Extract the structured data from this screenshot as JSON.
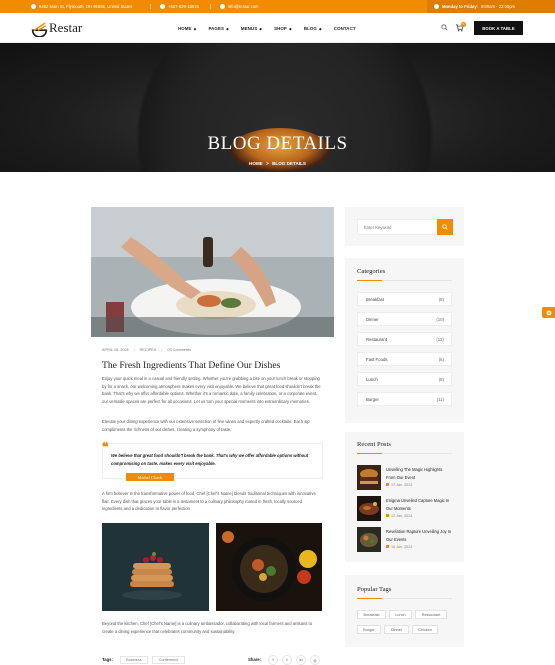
{
  "topbar": {
    "address": "9482 Main St, Plymouth, OH 95665, United States",
    "phone": "+567-629-18615",
    "email": "info@restar.com",
    "hours_label": "Monday to Friday:",
    "hours_value": "9:00am - 22:00pm"
  },
  "header": {
    "logo": "Restar",
    "nav": [
      "HOME",
      "PAGES",
      "MENUS",
      "SHOP",
      "BLOG",
      "CONTACT"
    ],
    "cart_count": "0",
    "book_label": "BOOK A TABLE"
  },
  "hero": {
    "title": "BLOG DETAILS",
    "breadcrumb_home": "HOME",
    "breadcrumb_sep": ">",
    "breadcrumb_current": "BLOG DETAILS"
  },
  "post": {
    "date": "APRIL 16, 2024",
    "category": "RECIPES",
    "comments": "03 Comments",
    "title": "The Fresh Ingredients That Define Our Dishes",
    "para1": "Enjoy your quick meal in a casual and friendly setting. Whether you're grabbing a bite on your lunch break or stopping by for a snack, our welcoming atmosphere makes every visit enjoyable. We believe that great food shouldn't break the bank. That's why we offer affordable options. Whether it's a romantic date, a family celebration, or a corporate event, our versatile spaces are perfect for all occasions. Let us turn your special moments into extraordinary memories.",
    "para2": "Elevate your dining experience with our extensive selection of fine wines and expertly crafted cocktails. Each sip compliments the richness of our dishes, creating a symphony of taste.",
    "quote": "We believe that great food shouldn't break the bank. That's why we offer affordable options without compromising on taste. makes every visit enjoyable.",
    "quote_author": "Michel Clarck",
    "para3": "A firm believer in the transformative power of food, Chef [Chef's Name] blends traditional techniques with innovative flair. Every dish that graces your table is a testament to a culinary philosophy rooted in fresh, locally sourced ingredients and a dedication to flavor perfection.",
    "para4": "Beyond the kitchen, Chef [Chef's Name] is a culinary ambassador, collaborating with local farmers and artisans to create a dining experience that celebrates community and sustainability.",
    "tags_label": "Tags:",
    "tags": [
      "Business",
      "Conference"
    ],
    "share_label": "Share:",
    "share_icons": [
      "f",
      "t",
      "in",
      "◎"
    ]
  },
  "sidebar": {
    "search_placeholder": "Enter Keyword",
    "categories_heading": "Categories",
    "categories": [
      {
        "name": "Breakfast",
        "count": "(8)"
      },
      {
        "name": "Dinner",
        "count": "(10)"
      },
      {
        "name": "Restaurant",
        "count": "(12)"
      },
      {
        "name": "Fast Foods",
        "count": "(6)"
      },
      {
        "name": "Lunch",
        "count": "(8)"
      },
      {
        "name": "Burger",
        "count": "(11)"
      }
    ],
    "recent_heading": "Recent Posts",
    "recent": [
      {
        "title": "Unveiling The Magic Highlights From Our Event",
        "date": "17 Jan, 2024"
      },
      {
        "title": "Enigma Unveiled Capture Magic In Our Moments",
        "date": "12 Jan, 2024"
      },
      {
        "title": "Revelation Rapture Unveiling Joy In Our Events",
        "date": "16 Jan, 2024"
      }
    ],
    "tags_heading": "Popular Tags",
    "tags": [
      "Breakfast",
      "Lunch",
      "Restaurant",
      "Burger",
      "Dinner",
      "Chicken"
    ]
  },
  "colors": {
    "accent": "#f28b00",
    "dark": "#111111"
  }
}
